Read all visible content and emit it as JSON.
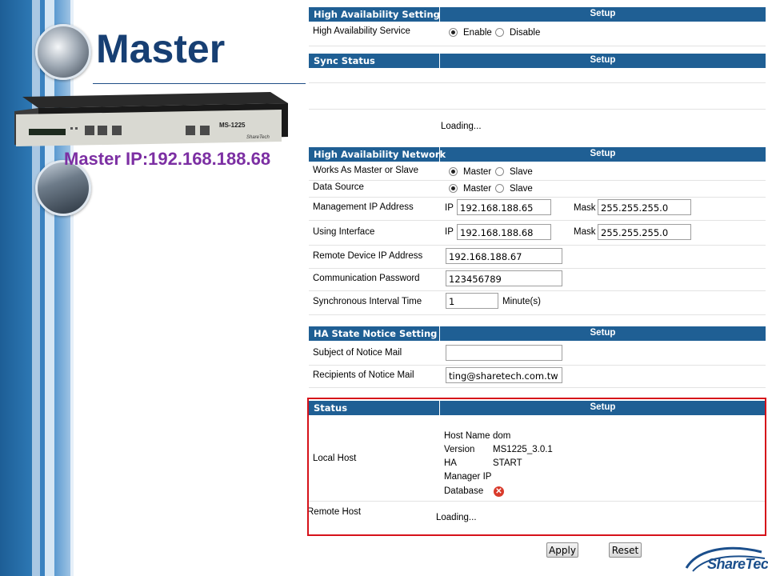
{
  "slide": {
    "title": "Master",
    "master_ip_label": "Master IP:192.168.188.68",
    "device_model": "MS-1225",
    "device_brand": "ShareTech",
    "logo_text": "ShareTech"
  },
  "ha_setting": {
    "header": "High Availability Setting",
    "setup": "Setup",
    "service_label": "High Availability Service",
    "enable_label": "Enable",
    "disable_label": "Disable",
    "selected": "Enable"
  },
  "sync_status": {
    "header": "Sync Status",
    "setup": "Setup",
    "loading": "Loading..."
  },
  "ha_network": {
    "header": "High Availability Network",
    "setup": "Setup",
    "works_as_label": "Works As Master or Slave",
    "data_source_label": "Data Source",
    "master_label": "Master",
    "slave_label": "Slave",
    "mgmt_ip_label": "Management IP Address",
    "ip_prefix": "IP",
    "mask_prefix": "Mask",
    "mgmt_ip": "192.168.188.65",
    "mgmt_mask": "255.255.255.0",
    "using_iface_label": "Using Interface",
    "iface_ip": "192.168.188.68",
    "iface_mask": "255.255.255.0",
    "remote_ip_label": "Remote Device IP Address",
    "remote_ip": "192.168.188.67",
    "password_label": "Communication Password",
    "password": "123456789",
    "interval_label": "Synchronous Interval Time",
    "interval": "1",
    "interval_unit": "Minute(s)"
  },
  "notice": {
    "header": "HA State Notice Setting",
    "setup": "Setup",
    "subject_label": "Subject of Notice Mail",
    "subject": "",
    "recipients_label": "Recipients of Notice Mail",
    "recipients": "ting@sharetech.com.tw"
  },
  "status": {
    "header": "Status",
    "setup": "Setup",
    "local_host_label": "Local Host",
    "host_name_label": "Host Name",
    "host_name": "dom",
    "version_label": "Version",
    "version": "MS1225_3.0.1",
    "ha_label": "HA",
    "ha": "START",
    "manager_ip_label": "Manager IP",
    "manager_ip": "",
    "database_label": "Database",
    "database_icon": "error-icon",
    "remote_host_label": "Remote Host",
    "remote_loading": "Loading..."
  },
  "actions": {
    "apply": "Apply",
    "reset": "Reset"
  }
}
